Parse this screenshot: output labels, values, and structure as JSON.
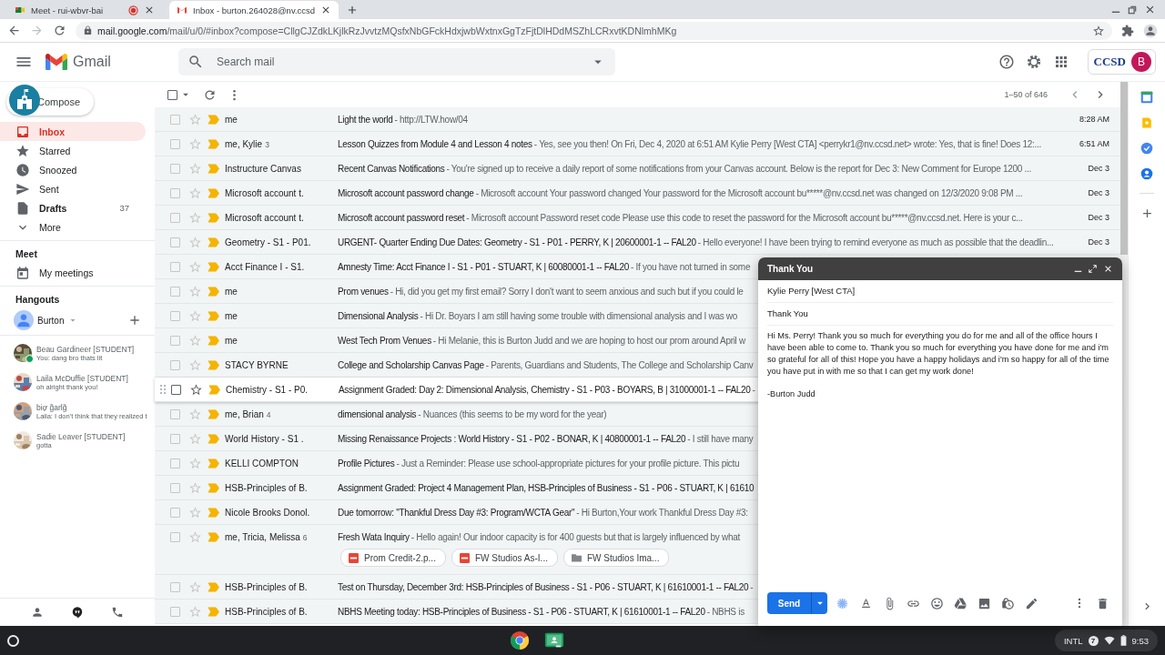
{
  "browser": {
    "tabs": [
      {
        "title": "Meet - rui-wbvr-bai",
        "kind": "meet",
        "recording": true,
        "selected": false
      },
      {
        "title": "Inbox - burton.264028@nv.ccsd",
        "kind": "gmail",
        "recording": false,
        "selected": true
      }
    ],
    "url_host": "mail.google.com",
    "url_path": "/mail/u/0/#inbox?compose=CllgCJZdkLKjlkRzJvvtzMQsfxNbGFckHdxjwbWxtnxGgTzFjtDlHDdMSZhLCRxvtKDNlmhMKg",
    "forward_disabled": true
  },
  "header": {
    "app_name": "Gmail",
    "search_placeholder": "Search mail",
    "org_logo": "CCSD",
    "avatar_letter": "B"
  },
  "toolbar": {
    "range": "1–50 of 646",
    "select_all": false
  },
  "sidebar": {
    "compose": "Compose",
    "items": [
      {
        "label": "Inbox",
        "kind": "inbox",
        "selected": true,
        "bold": true
      },
      {
        "label": "Starred",
        "kind": "star",
        "selected": false,
        "bold": false
      },
      {
        "label": "Snoozed",
        "kind": "clock",
        "selected": false,
        "bold": false
      },
      {
        "label": "Sent",
        "kind": "send",
        "selected": false,
        "bold": false
      },
      {
        "label": "Drafts",
        "kind": "file",
        "selected": false,
        "bold": true,
        "count": "37"
      },
      {
        "label": "More",
        "kind": "more",
        "selected": false,
        "bold": false
      }
    ],
    "meet": {
      "title": "Meet",
      "item": "My meetings"
    },
    "hangouts": {
      "title": "Hangouts",
      "user": "Burton",
      "chats": [
        {
          "name": "Beau Gardineer [STUDENT]",
          "message": "You: dang bro thats lit",
          "online": true
        },
        {
          "name": "Laila McDuffie [STUDENT]",
          "message": "oh alright thank you!",
          "online": false
        },
        {
          "name": "biợ g̃arlg̃",
          "message": "Laila: I don't think that they realized t",
          "online": false
        },
        {
          "name": "Sadie Leaver [STUDENT]",
          "message": "gotta",
          "online": false
        }
      ]
    }
  },
  "emails": [
    {
      "sender": "me",
      "subject": "Light the world",
      "snippet": "- http://LTW.how/04",
      "date": "8:28 AM",
      "important": true,
      "starred": false,
      "hovered": false
    },
    {
      "sender": "me, Kylie",
      "count": "3",
      "subject": "Lesson Quizzes from Module 4 and Lesson 4 notes",
      "snippet": "- Yes, see you then! On Fri, Dec 4, 2020 at 6:51 AM Kylie Perry [West CTA] <perrykr1@nv.ccsd.net> wrote: Yes, that is fine! Does 12:...",
      "date": "6:51 AM",
      "important": true,
      "starred": false,
      "hovered": false
    },
    {
      "sender": "Instructure Canvas",
      "subject": "Recent Canvas Notifications",
      "snippet": "- You're signed up to receive a daily report of some notifications from your Canvas account. Below is the report for Dec 3: New Comment for Europe 1200 ...",
      "date": "Dec 3",
      "important": true,
      "starred": false,
      "hovered": false
    },
    {
      "sender": "Microsoft account t.",
      "subject": "Microsoft account password change",
      "snippet": "- Microsoft account Your password changed Your password for the Microsoft account bu*****@nv.ccsd.net was changed on 12/3/2020 9:08 PM ...",
      "date": "Dec 3",
      "important": true,
      "starred": false,
      "hovered": false
    },
    {
      "sender": "Microsoft account t.",
      "subject": "Microsoft account password reset",
      "snippet": "- Microsoft account Password reset code Please use this code to reset the password for the Microsoft account bu*****@nv.ccsd.net. Here is your c...",
      "date": "Dec 3",
      "important": true,
      "starred": false,
      "hovered": false
    },
    {
      "sender": "Geometry - S1 - P01.",
      "subject": "URGENT- Quarter Ending Due Dates: Geometry - S1 - P01 - PERRY, K | 20600001-1 -- FAL20",
      "snippet": "- Hello everyone! I have been trying to remind everyone as much as possible that the deadlin...",
      "date": "Dec 3",
      "important": true,
      "starred": false,
      "hovered": false
    },
    {
      "sender": "Acct Finance I - S1.",
      "subject": "Amnesty Time: Acct Finance I - S1 - P01 - STUART, K | 60080001-1 -- FAL20",
      "snippet": "- If you have not turned in some",
      "important": true,
      "starred": false,
      "hovered": false
    },
    {
      "sender": "me",
      "subject": "Prom venues",
      "snippet": "- Hi, did you get my first email? Sorry I don't want to seem anxious and such but if you could le",
      "important": true,
      "starred": false,
      "hovered": false
    },
    {
      "sender": "me",
      "subject": "Dimensional Analysis",
      "snippet": "- Hi Dr. Boyars I am still having some trouble with dimensional analysis and I was wo",
      "important": true,
      "starred": false,
      "hovered": false
    },
    {
      "sender": "me",
      "subject": "West Tech Prom Venues",
      "snippet": "- Hi Melanie, this is Burton Judd and we are hoping to host our prom around April w",
      "important": true,
      "starred": false,
      "hovered": false
    },
    {
      "sender": "STACY BYRNE",
      "subject": "College and Scholarship Canvas Page",
      "snippet": "- Parents, Guardians and Students, The College and Scholarship Canv",
      "important": true,
      "starred": false,
      "hovered": false
    },
    {
      "sender": "Chemistry - S1 - P0.",
      "subject": "Assignment Graded: Day 2: Dimensional Analysis, Chemistry - S1 - P03 - BOYARS, B | 31000001-1 -- FAL20",
      "snippet": "-",
      "important": true,
      "starred": false,
      "hovered": true
    },
    {
      "sender": "me, Brian",
      "count": "4",
      "subject": "dimensional analysis",
      "snippet": "- Nuances (this seems to be my word for the year)",
      "important": true,
      "starred": false,
      "hovered": false
    },
    {
      "sender": "World History - S1 .",
      "subject": "Missing Renaissance Projects : World History - S1 - P02 - BONAR, K | 40800001-1 -- FAL20",
      "snippet": "- I still have many",
      "important": true,
      "starred": false,
      "hovered": false
    },
    {
      "sender": "KELLI COMPTON",
      "subject": "Profile Pictures",
      "snippet": "- Just a Reminder: Please use school-appropriate pictures for your profile picture. This pictu",
      "important": true,
      "starred": false,
      "hovered": false
    },
    {
      "sender": "HSB-Principles of B.",
      "subject": "Assignment Graded: Project 4 Management Plan, HSB-Principles of Business - S1 - P06 - STUART, K | 61610",
      "important": true,
      "starred": false,
      "hovered": false
    },
    {
      "sender": "Nicole Brooks Donol.",
      "subject": "Due tomorrow: \"Thankful Dress Day #3: Program/WCTA Gear\"",
      "snippet": "- Hi Burton,Your work Thankful Dress Day #3:",
      "important": true,
      "starred": false,
      "hovered": false
    },
    {
      "sender": "me, Tricia, Melissa",
      "count": "6",
      "subject": "Fresh Wata Inquiry",
      "snippet": "- Hello again! Our indoor capacity is for 400 guests but that is largely influenced by what",
      "important": true,
      "starred": false,
      "hovered": false,
      "attachments": [
        {
          "name": "Prom Credit-2.p...",
          "kind": "pdf"
        },
        {
          "name": "FW Studios As-I...",
          "kind": "pdf"
        },
        {
          "name": "FW Studios Ima...",
          "kind": "folder"
        }
      ]
    },
    {
      "sender": "HSB-Principles of B.",
      "subject": "Test on Thursday, December 3rd: HSB-Principles of Business - S1 - P06 - STUART, K | 61610001-1 -- FAL20",
      "snippet": "-",
      "important": true,
      "starred": false,
      "hovered": false
    },
    {
      "sender": "HSB-Principles of B.",
      "subject": "NBHS Meeting today: HSB-Principles of Business - S1 - P06 - STUART, K | 61610001-1 -- FAL20",
      "snippet": "- NBHS is",
      "important": true,
      "starred": false,
      "hovered": false
    }
  ],
  "compose": {
    "title": "Thank You",
    "to": "Kylie Perry [West CTA]",
    "subject": "Thank You",
    "body": [
      "Hi Ms. Perry! Thank you so much for everything you do for me and all of the office hours I have been able to come to. Thank you so much for everything you have done for me and i'm so grateful for all of this! Hope you have a happy holidays and i'm so happy for all of the time you have put in with me so that I can get my work done!",
      "-Burton Judd"
    ],
    "send": "Send"
  },
  "shelf": {
    "ime": "INTL",
    "notifications": "7",
    "time": "9:53"
  }
}
